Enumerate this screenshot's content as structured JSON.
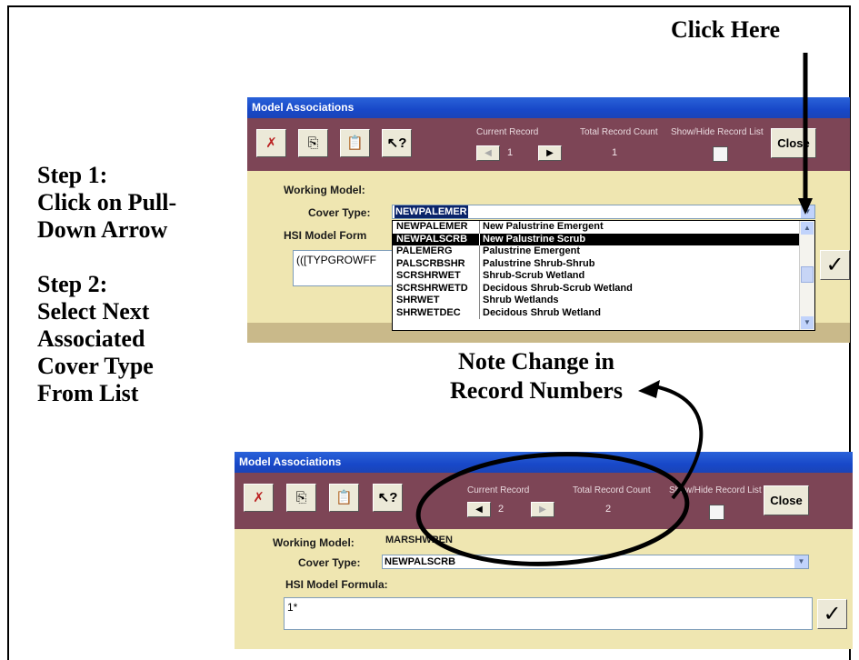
{
  "annotations": {
    "click_here": "Click Here",
    "steps": [
      "Step 1:",
      "Click on Pull-",
      "Down Arrow",
      "",
      "Step 2:",
      "Select Next",
      "Associated",
      "Cover Type",
      "From List"
    ],
    "note": [
      "Note Change in",
      "Record Numbers"
    ]
  },
  "dialog_before": {
    "title": "Model Associations",
    "toolbar": {
      "current_record_label": "Current Record",
      "total_record_label": "Total Record Count",
      "show_hide_label": "Show/Hide Record List",
      "current_record": "1",
      "total_record": "1",
      "close_label": "Close"
    },
    "working_model_label": "Working Model:",
    "cover_type_label": "Cover Type:",
    "cover_type_value": "NEWPALEMER",
    "hsi_label": "HSI Model Form",
    "hsi_formula": "(([TYPGROWFF",
    "dropdown_items": [
      {
        "code": "NEWPALEMER",
        "name": "New Palustrine Emergent",
        "selected": false
      },
      {
        "code": "NEWPALSCRB",
        "name": "New Palustrine Scrub",
        "selected": true
      },
      {
        "code": "PALEMERG",
        "name": "Palustrine Emergent",
        "selected": false
      },
      {
        "code": "PALSCRBSHR",
        "name": "Palustrine Shrub-Shrub",
        "selected": false
      },
      {
        "code": "SCRSHRWET",
        "name": "Shrub-Scrub Wetland",
        "selected": false
      },
      {
        "code": "SCRSHRWETD",
        "name": "Decidous Shrub-Scrub Wetland",
        "selected": false
      },
      {
        "code": "SHRWET",
        "name": "Shrub Wetlands",
        "selected": false
      },
      {
        "code": "SHRWETDEC",
        "name": "Decidous Shrub Wetland",
        "selected": false
      }
    ]
  },
  "dialog_after": {
    "title": "Model Associations",
    "toolbar": {
      "current_record_label": "Current Record",
      "total_record_label": "Total Record Count",
      "show_hide_label": "Show/Hide Record List",
      "current_record": "2",
      "total_record": "2",
      "close_label": "Close"
    },
    "working_model_label": "Working Model:",
    "working_model_value": "MARSHWREN",
    "cover_type_label": "Cover Type:",
    "cover_type_value": "NEWPALSCRB",
    "hsi_label": "HSI Model Formula:",
    "hsi_formula": "1*"
  },
  "icons": {
    "delete": "delete-record-icon",
    "copy": "copy-icon",
    "paste": "paste-icon",
    "help": "whats-this-help-icon",
    "check": "checkmark-icon"
  }
}
